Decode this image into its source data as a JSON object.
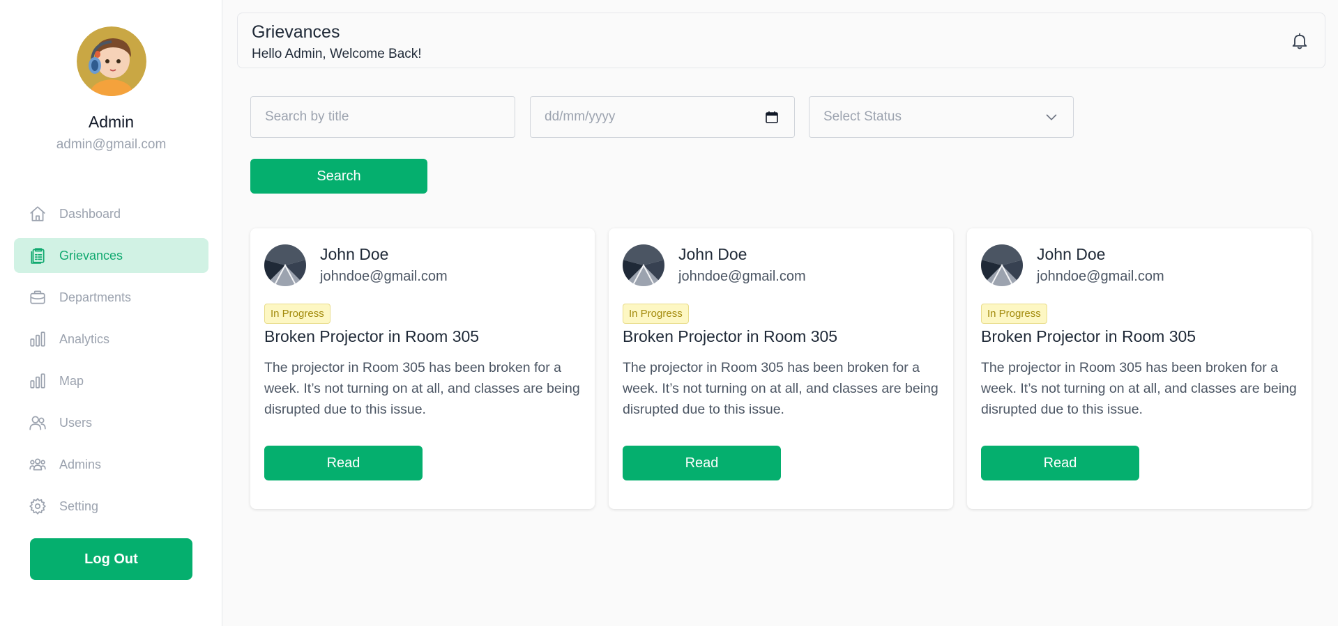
{
  "profile": {
    "name": "Admin",
    "email": "admin@gmail.com"
  },
  "sidebar": {
    "items": [
      {
        "label": "Dashboard",
        "icon": "home-icon"
      },
      {
        "label": "Grievances",
        "icon": "clipboard-icon",
        "active": true
      },
      {
        "label": "Departments",
        "icon": "briefcase-icon"
      },
      {
        "label": "Analytics",
        "icon": "bar-chart-icon"
      },
      {
        "label": "Map",
        "icon": "bar-chart-icon"
      },
      {
        "label": "Users",
        "icon": "users-icon"
      },
      {
        "label": "Admins",
        "icon": "group-icon"
      },
      {
        "label": "Setting",
        "icon": "gear-icon"
      }
    ],
    "logout_label": "Log Out"
  },
  "header": {
    "title": "Grievances",
    "subtitle": "Hello Admin, Welcome Back!"
  },
  "filters": {
    "search_placeholder": "Search by title",
    "date_placeholder": "dd/mm/yyyy",
    "status_placeholder": "Select Status",
    "search_button": "Search"
  },
  "grievances": [
    {
      "name": "John Doe",
      "email": "johndoe@gmail.com",
      "status": "In Progress",
      "title": "Broken Projector in Room 305",
      "description": "The projector in Room 305 has been broken for a week. It’s not turning on at all, and classes are being disrupted due to this issue.",
      "action": "Read"
    },
    {
      "name": "John Doe",
      "email": "johndoe@gmail.com",
      "status": "In Progress",
      "title": "Broken Projector in Room 305",
      "description": "The projector in Room 305 has been broken for a week. It’s not turning on at all, and classes are being disrupted due to this issue.",
      "action": "Read"
    },
    {
      "name": "John Doe",
      "email": "johndoe@gmail.com",
      "status": "In Progress",
      "title": "Broken Projector in Room 305",
      "description": "The projector in Room 305 has been broken for a week. It’s not turning on at all, and classes are being disrupted due to this issue.",
      "action": "Read"
    }
  ],
  "colors": {
    "accent": "#05af6e",
    "active_bg": "#d1f2e4",
    "badge_bg": "#fdf7c3",
    "badge_text": "#a28a0c"
  }
}
